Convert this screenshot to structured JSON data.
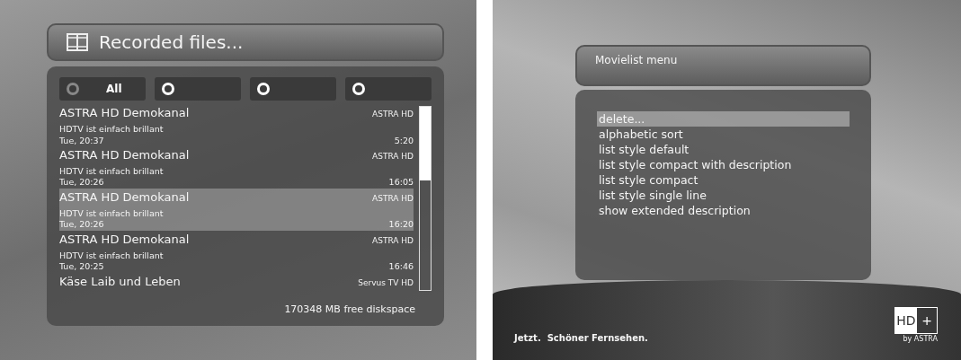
{
  "recordings_screen": {
    "title": "Recorded files...",
    "filters": [
      {
        "label": "All",
        "selected": true
      },
      {
        "selected": false
      },
      {
        "selected": false
      },
      {
        "selected": false
      }
    ],
    "recordings": [
      {
        "title": "ASTRA HD Demokanal",
        "channel": "ASTRA HD",
        "description": "HDTV ist einfach brillant",
        "date": "Tue, 20:37",
        "duration": "5:20",
        "selected": false
      },
      {
        "title": "ASTRA HD Demokanal",
        "channel": "ASTRA HD",
        "description": "HDTV ist einfach brillant",
        "date": "Tue, 20:26",
        "duration": "16:05",
        "selected": false
      },
      {
        "title": "ASTRA HD Demokanal",
        "channel": "ASTRA HD",
        "description": "HDTV ist einfach brillant",
        "date": "Tue, 20:26",
        "duration": "16:20",
        "selected": true
      },
      {
        "title": "ASTRA HD Demokanal",
        "channel": "ASTRA HD",
        "description": "HDTV ist einfach brillant",
        "date": "Tue, 20:25",
        "duration": "16:46",
        "selected": false
      },
      {
        "title": "Käse Laib und Leben",
        "channel": "Servus TV HD",
        "selected": false
      }
    ],
    "free_space": "170348 MB free diskspace"
  },
  "menu_screen": {
    "title": "Movielist menu",
    "items": [
      {
        "label": "delete...",
        "selected": true
      },
      {
        "label": "alphabetic sort",
        "selected": false
      },
      {
        "label": "list style default",
        "selected": false
      },
      {
        "label": "list style compact with description",
        "selected": false
      },
      {
        "label": "list style compact",
        "selected": false
      },
      {
        "label": "list style single line",
        "selected": false
      },
      {
        "label": "show extended description",
        "selected": false
      }
    ],
    "slogan": "Jetzt.  Schöner Fernsehen.",
    "logo": {
      "left": "HD",
      "right": "+",
      "byline": "by ASTRA"
    }
  }
}
